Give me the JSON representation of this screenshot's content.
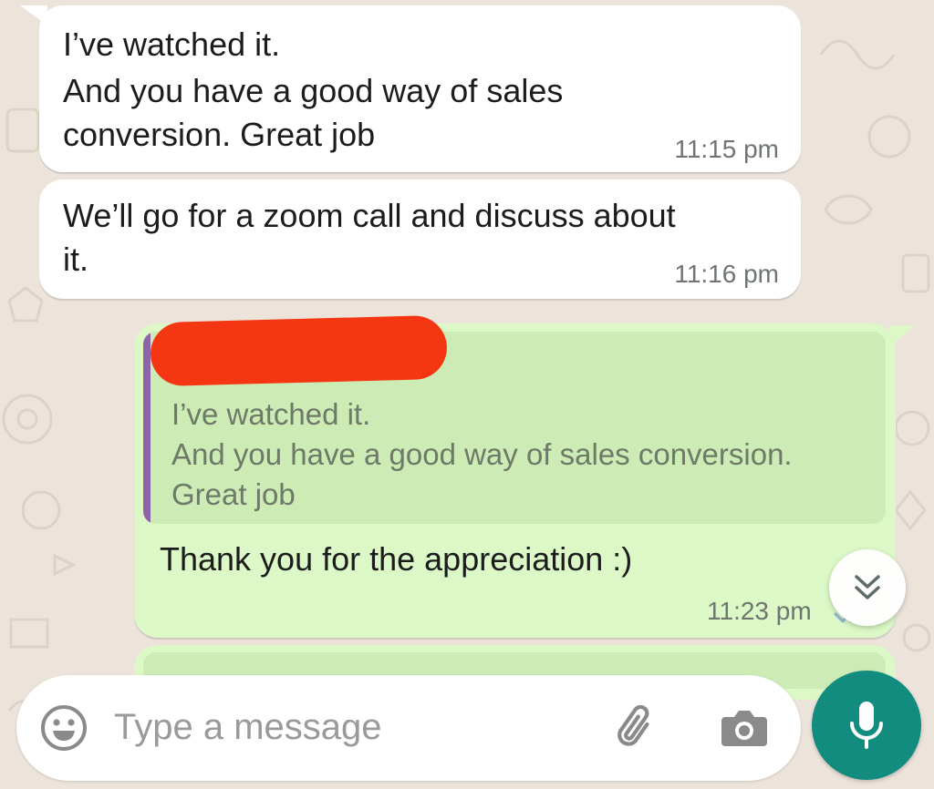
{
  "messages": [
    {
      "direction": "incoming",
      "lines": [
        "I’ve watched it.",
        "And you have a good way of sales",
        "conversion. Great job"
      ],
      "time": "11:15 pm"
    },
    {
      "direction": "incoming",
      "lines": [
        "We’ll go for a zoom call and discuss about",
        "it."
      ],
      "time": "11:16 pm"
    },
    {
      "direction": "outgoing",
      "reply_to": {
        "sender": "",
        "lines": [
          "I’ve watched it.",
          "And you have a good way of sales conversion.",
          "Great job"
        ]
      },
      "text": "Thank you for the appreciation :)",
      "time": "11:23 pm",
      "status_icon": "double-check-icon"
    }
  ],
  "scroll_button": {
    "icon": "double-chevron-down-icon"
  },
  "composer": {
    "placeholder": "Type a message",
    "emoji_icon": "smiley-icon",
    "attach_icon": "paperclip-icon",
    "camera_icon": "camera-icon",
    "send_icon": "microphone-icon"
  },
  "colors": {
    "incoming_bubble": "#ffffff",
    "outgoing_bubble": "#dbf8c6",
    "quote_background": "#cdebb5",
    "quote_accent": "#8e64a8",
    "accent": "#128c7e",
    "wallpaper": "#ece4db",
    "redaction": "#f43712"
  }
}
